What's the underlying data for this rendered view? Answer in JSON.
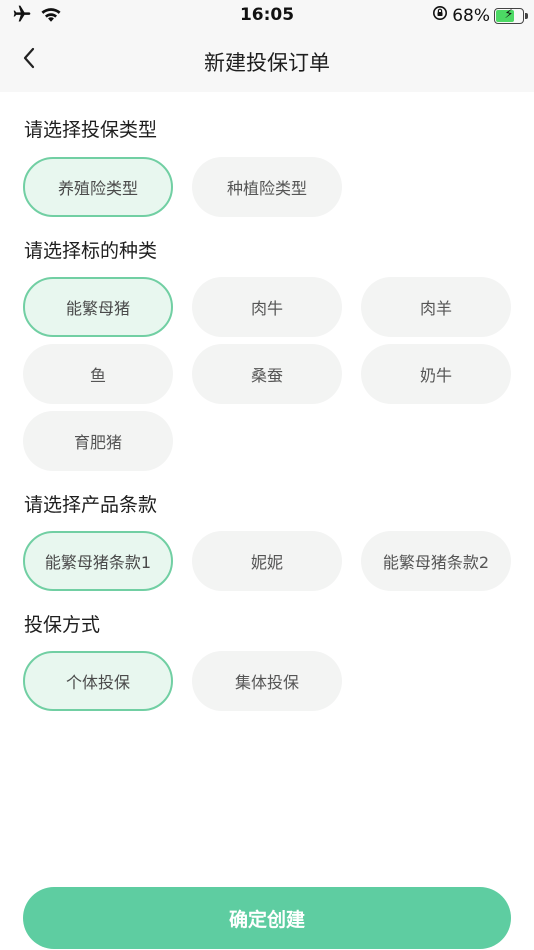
{
  "status_bar": {
    "time": "16:05",
    "battery_percent": "68%",
    "battery_level": 0.68,
    "icons": [
      "airplane-icon",
      "wifi-icon",
      "orientation-lock-icon",
      "battery-charging-icon"
    ]
  },
  "nav": {
    "title": "新建投保订单",
    "back_icon": "chevron-left-icon"
  },
  "sections": {
    "insurance_type": {
      "title": "请选择投保类型",
      "options": [
        "养殖险类型",
        "种植险类型"
      ],
      "selected": "养殖险类型"
    },
    "subject_type": {
      "title": "请选择标的种类",
      "options": [
        "能繁母猪",
        "肉牛",
        "肉羊",
        "鱼",
        "桑蚕",
        "奶牛",
        "育肥猪"
      ],
      "selected": "能繁母猪"
    },
    "product_terms": {
      "title": "请选择产品条款",
      "options": [
        "能繁母猪条款1",
        "妮妮",
        "能繁母猪条款2"
      ],
      "selected": "能繁母猪条款1"
    },
    "insure_method": {
      "title": "投保方式",
      "options": [
        "个体投保",
        "集体投保"
      ],
      "selected": "个体投保"
    }
  },
  "confirm_button": "确定创建",
  "colors": {
    "accent": "#5ecda1",
    "chip_selected_bg": "#e8f7ef",
    "chip_selected_border": "#71cfa3",
    "chip_bg": "#f3f4f3",
    "header_bg": "#f7f7f7"
  }
}
